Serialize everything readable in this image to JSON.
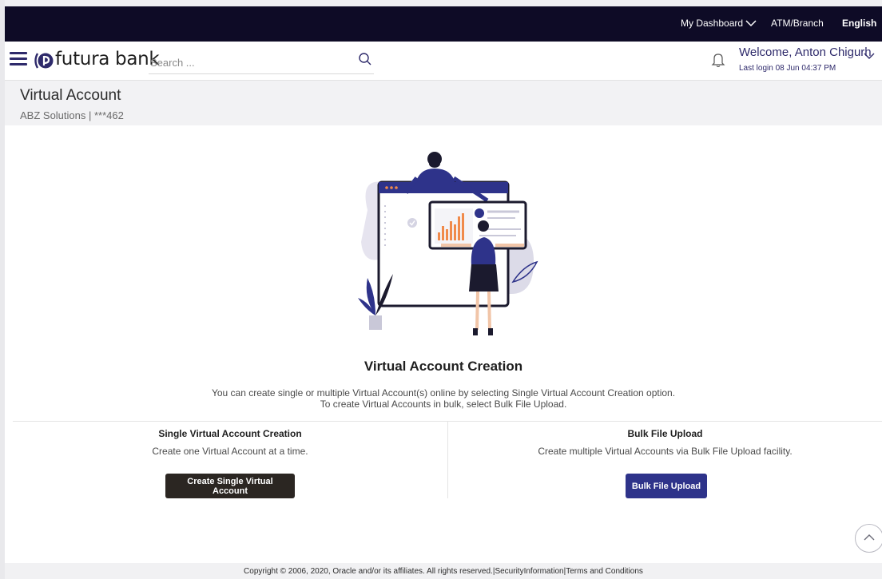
{
  "topbar": {
    "dashboard_label": "My Dashboard",
    "atm_label": "ATM/Branch",
    "language_label": "English"
  },
  "header": {
    "brand_name": "futura bank",
    "search_placeholder": "Search ...",
    "welcome_text": "Welcome, Anton Chigurh",
    "last_login": "Last login 08 Jun 04:37 PM"
  },
  "page": {
    "title": "Virtual Account",
    "subtitle": "ABZ Solutions | ***462"
  },
  "creation": {
    "title": "Virtual Account Creation",
    "desc_line1": "You can create single or multiple Virtual Account(s) online by selecting Single Virtual Account Creation option.",
    "desc_line2": "To create Virtual Accounts in bulk, select Bulk File Upload."
  },
  "single": {
    "title": "Single Virtual Account Creation",
    "desc": "Create one Virtual Account at a time.",
    "button_label": "Create Single Virtual Account"
  },
  "bulk": {
    "title": "Bulk File Upload",
    "desc": "Create multiple Virtual Accounts via Bulk File Upload facility.",
    "button_label": "Bulk File Upload"
  },
  "footer": {
    "copyright": "Copyright © 2006, 2020, Oracle and/or its affiliates. All rights reserved.",
    "sep1": "|",
    "security_link": "SecurityInformation",
    "sep2": "|",
    "terms_link": "Terms and Conditions"
  },
  "colors": {
    "topbar_bg": "#0e0b26",
    "brand_accent": "#2e2a6b",
    "primary_button": "#2e338a",
    "dark_button": "#2b2622"
  },
  "icons": {
    "menu": "hamburger-icon",
    "search": "search-icon",
    "notifications": "bell-icon",
    "scroll_top": "chevron-up-icon"
  }
}
